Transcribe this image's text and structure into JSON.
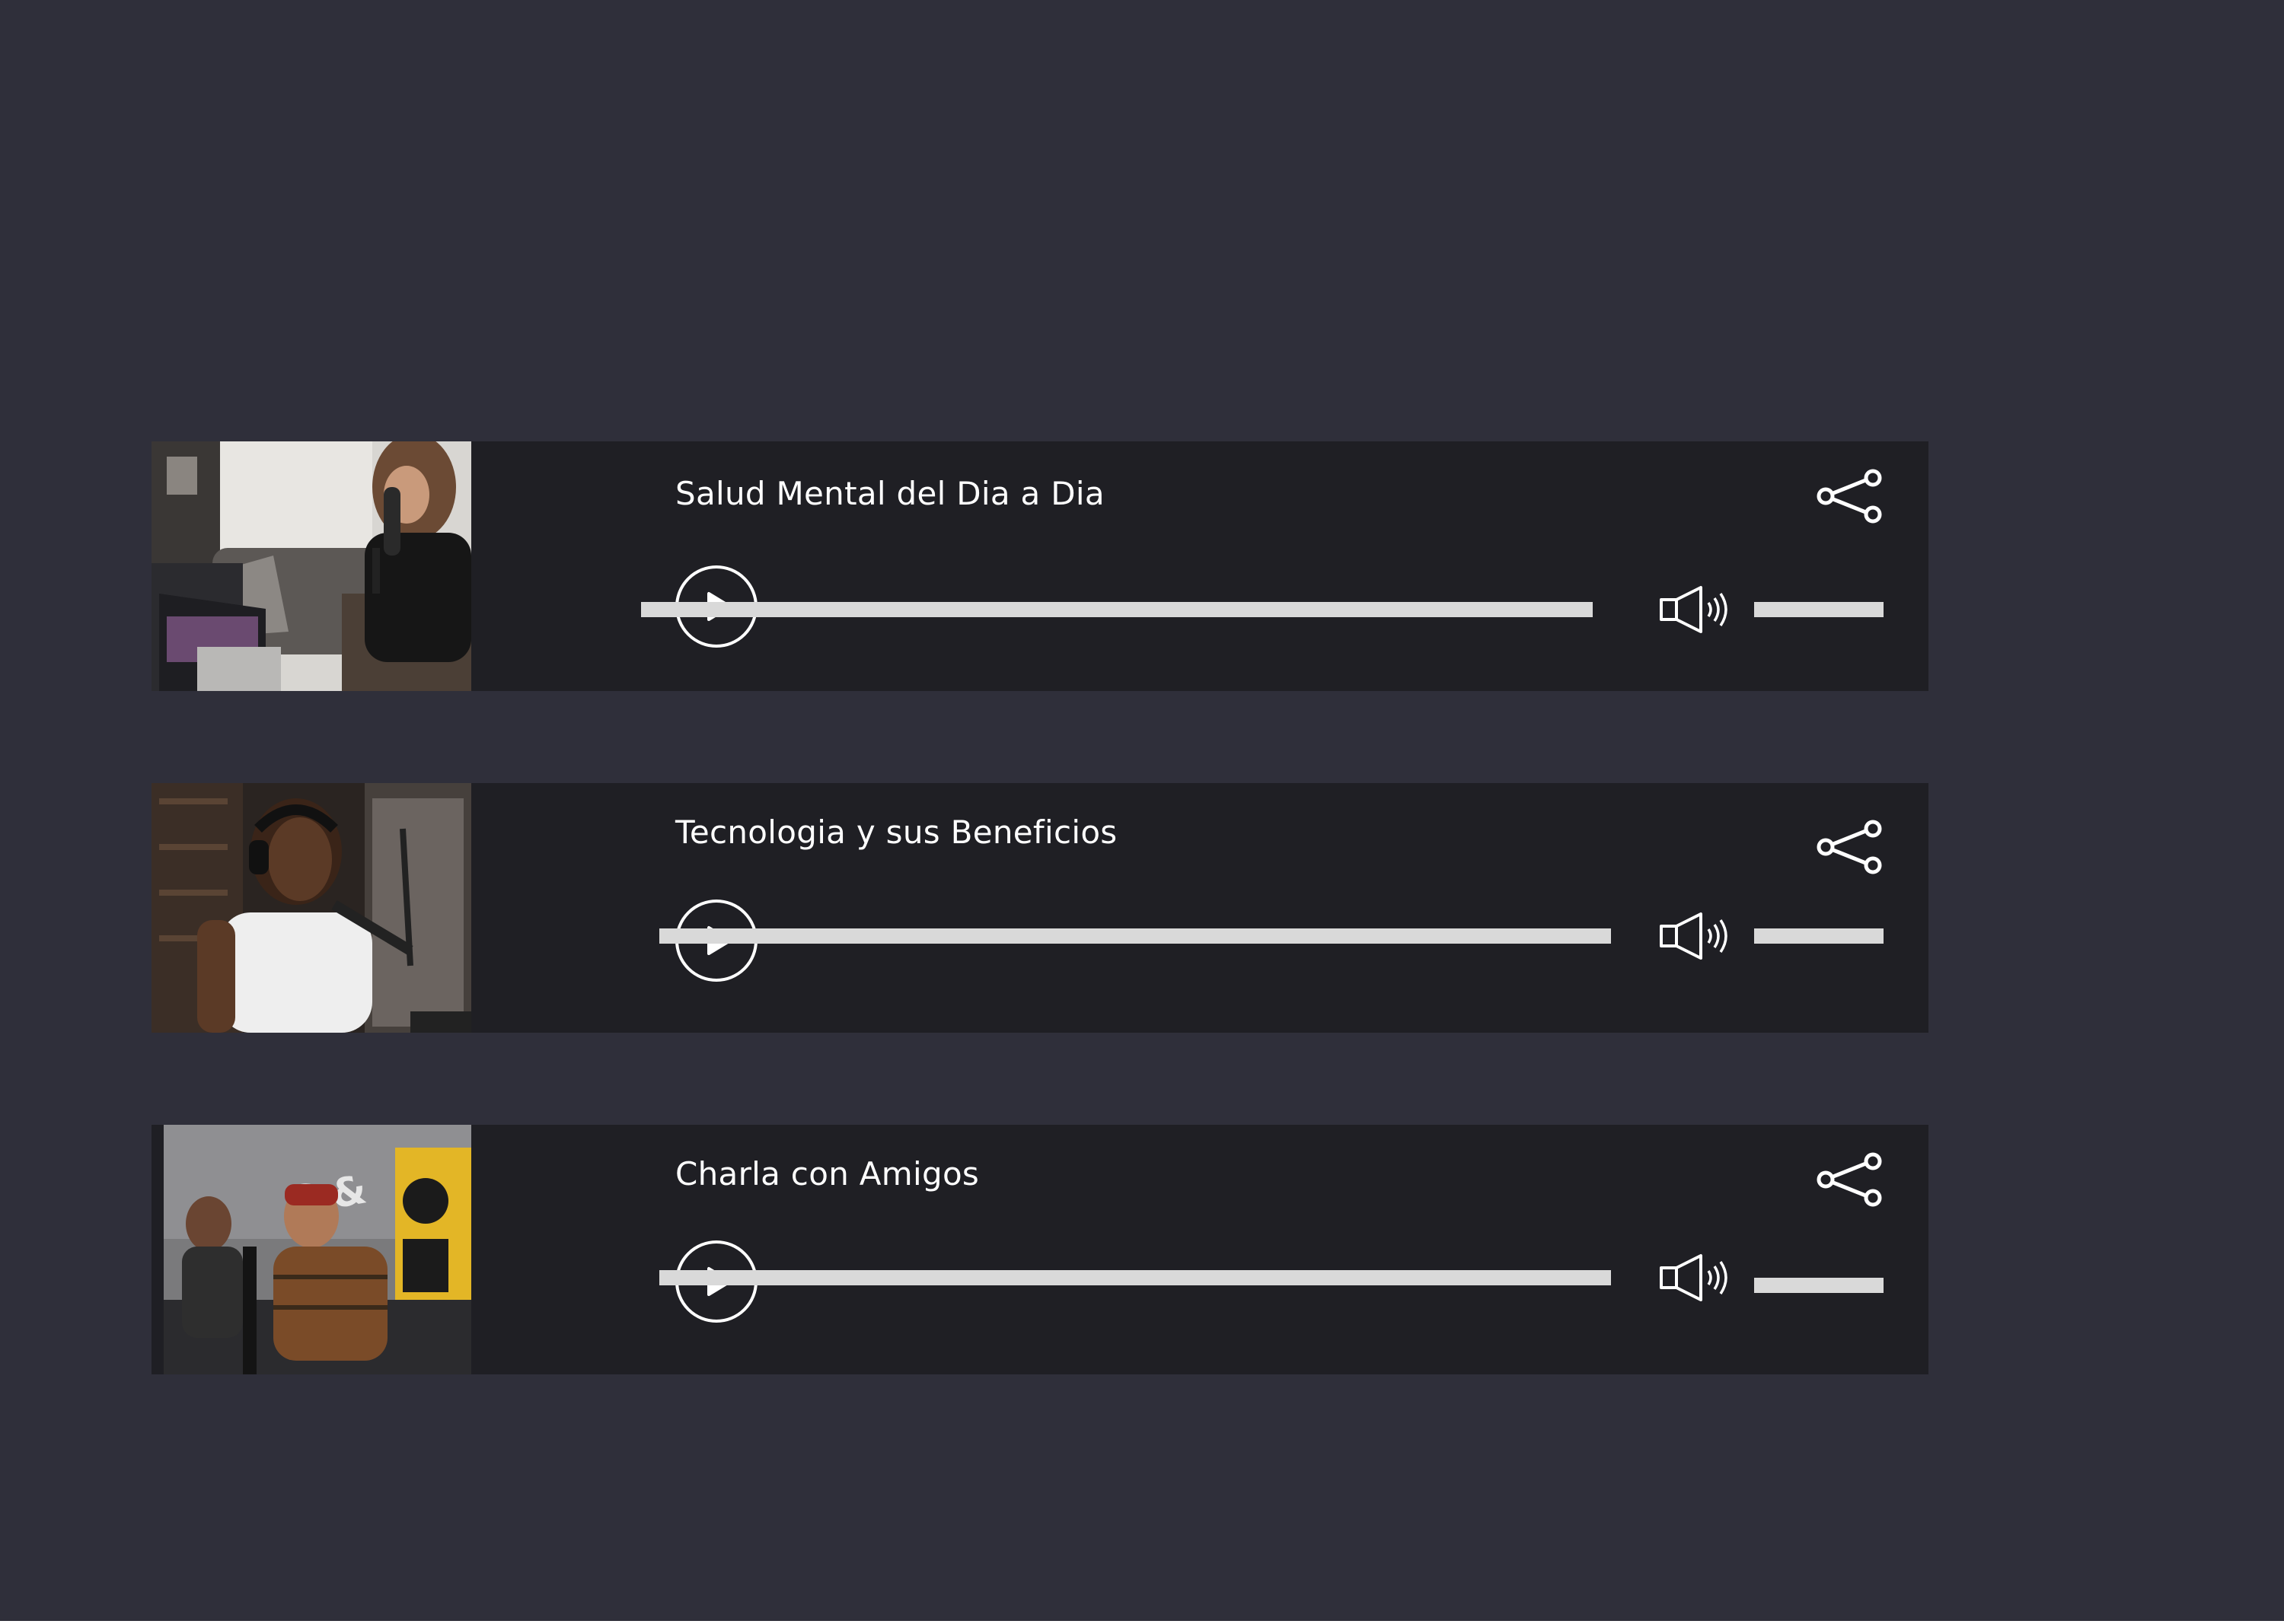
{
  "colors": {
    "background": "#2f2f3a",
    "card": "#1f1f24",
    "text": "#ffffff",
    "bar": "#d9d9d9"
  },
  "players": [
    {
      "title": "Salud Mental del Dia a Dia",
      "thumbnail": "woman-podcaster-microphone",
      "progress": 0,
      "volume": 1
    },
    {
      "title": "Tecnologia y sus Beneficios",
      "thumbnail": "man-with-headphones-microphone",
      "progress": 0,
      "volume": 1
    },
    {
      "title": "Charla con Amigos",
      "thumbnail": "two-men-laughing-podcast-studio",
      "progress": 0,
      "volume": 1
    }
  ],
  "icons": {
    "play": "play-icon",
    "share": "share-icon",
    "volume": "speaker-volume-icon"
  }
}
